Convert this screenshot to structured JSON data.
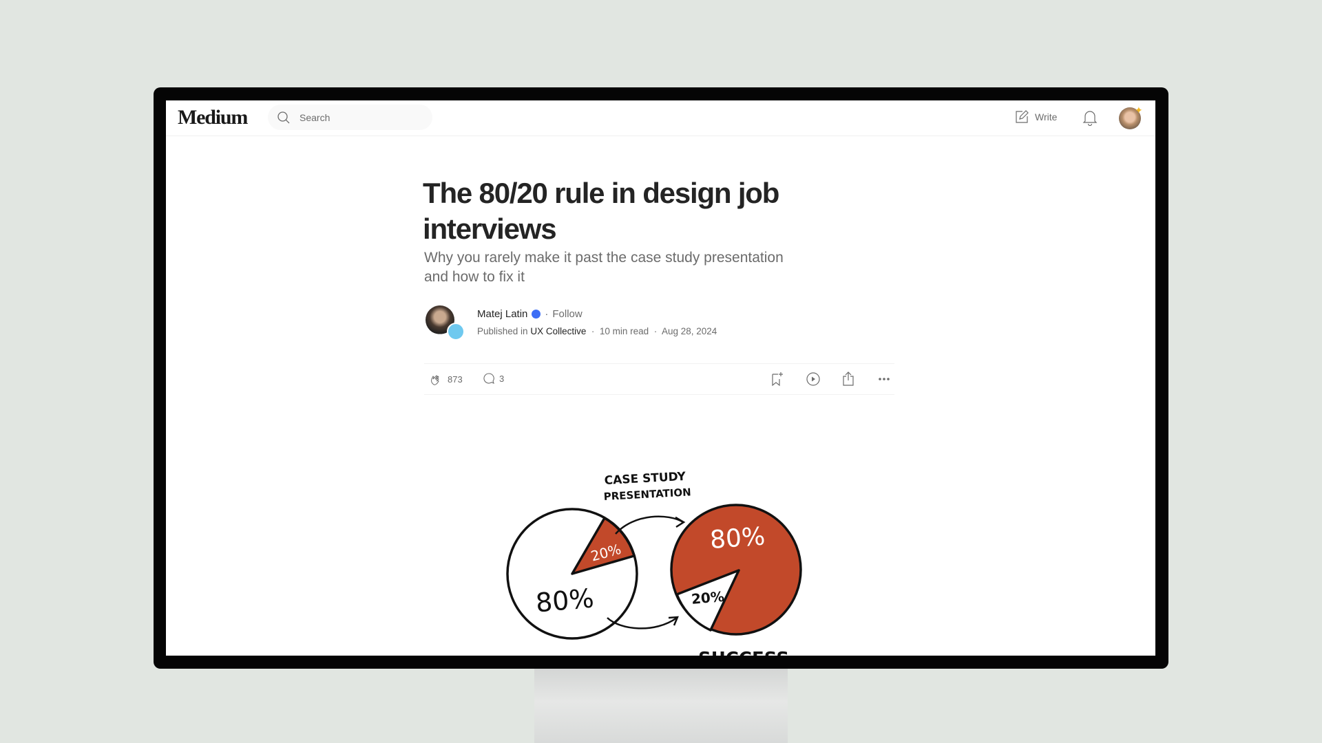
{
  "header": {
    "logo": "Medium",
    "search_placeholder": "Search",
    "write_label": "Write",
    "icons": [
      "search-icon",
      "write-icon",
      "bell-icon",
      "avatar"
    ]
  },
  "article": {
    "title": "The 80/20 rule in design job interviews",
    "subtitle": "Why you rarely make it past the case study presentation and how to fix it",
    "author": "Matej Latin",
    "follow": "Follow",
    "published_prefix": "Published in",
    "publication": "UX Collective",
    "read_time": "10 min read",
    "date": "Aug 28, 2024",
    "separator": "·",
    "claps": "873",
    "comments": "3"
  },
  "illustration": {
    "label_top_1": "CASE STUDY",
    "label_top_2": "PRESENTATION",
    "left_small": "20%",
    "left_large": "80%",
    "right_large": "80%",
    "right_small": "20%",
    "label_bottom": "SUCCESS",
    "accent_color": "#c2492a"
  }
}
